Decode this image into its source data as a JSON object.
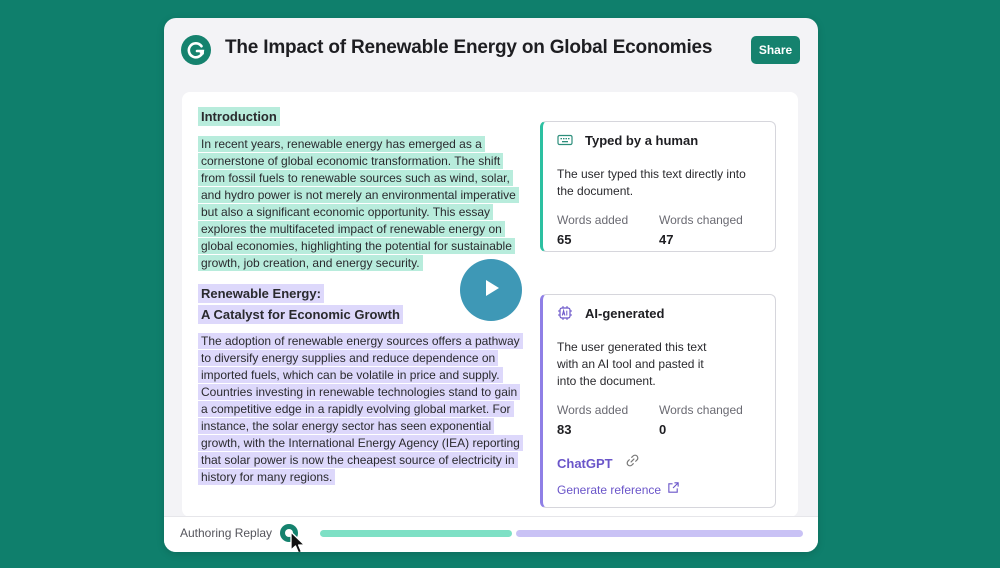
{
  "header": {
    "title": "The Impact of Renewable Energy on Global Economies",
    "share_label": "Share",
    "logo_icon": "grammarly-g-icon"
  },
  "document": {
    "sections": [
      {
        "heading": "Introduction",
        "paragraph": "In recent years, renewable energy has emerged as a cornerstone of global economic transformation. The shift from fossil fuels to renewable sources such as wind, solar, and hydro power is not merely an environmental imperative but also a significant economic opportunity. This essay explores the multifaceted impact of renewable energy on global economies, highlighting the potential for sustainable growth, job creation, and energy security."
      },
      {
        "heading_line1": "Renewable Energy:",
        "heading_line2": "A Catalyst for Economic Growth",
        "paragraph": "The adoption of renewable energy sources offers a pathway to diversify energy supplies and reduce dependence on imported fuels, which can be volatile in price and supply. Countries investing in renewable technologies stand to gain a competitive edge in a rapidly evolving global market. For instance, the solar energy sector has seen exponential growth, with the International Energy Agency (IEA) reporting that solar power is now the cheapest source of electricity in history for many regions."
      }
    ]
  },
  "cards": {
    "human": {
      "title": "Typed by a human",
      "description": "The user typed this text directly into the document.",
      "words_added_label": "Words added",
      "words_added": "65",
      "words_changed_label": "Words changed",
      "words_changed": "47",
      "accent": "#2cc0a1"
    },
    "ai": {
      "title": "AI-generated",
      "description": "The user generated this text with an AI tool and pasted it into the document.",
      "words_added_label": "Words added",
      "words_added": "83",
      "words_changed_label": "Words changed",
      "words_changed": "0",
      "tool_name": "ChatGPT",
      "reference_label": "Generate reference",
      "accent": "#8f7fe6"
    }
  },
  "footer": {
    "replay_label": "Authoring Replay"
  },
  "colors": {
    "background": "#0f7f6c",
    "brand": "#15826e",
    "human_highlight": "#b8ecdc",
    "ai_highlight": "#ddd8fb"
  }
}
